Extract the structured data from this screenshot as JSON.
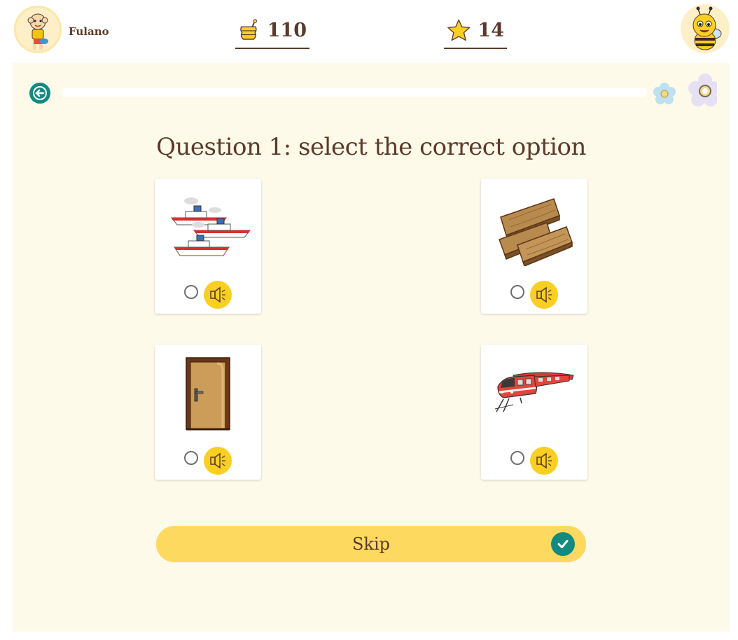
{
  "user": {
    "name": "Fulano",
    "avatar_icon": "child-character-avatar-icon"
  },
  "stats": {
    "honey": "110",
    "honey_icon": "honey-pot-icon",
    "stars": "14",
    "star_icon": "star-icon"
  },
  "mascot_icon": "bee-mascot-icon",
  "nav": {
    "back_icon": "back-arrow-icon"
  },
  "progress": {
    "fraction": 0.0,
    "markers": [
      "flower-icon",
      "flower-icon"
    ]
  },
  "question": {
    "title": "Question 1: select the correct option"
  },
  "options": [
    {
      "image": "ships-icon",
      "audio_icon": "speaker-icon"
    },
    {
      "image": "wooden-planks-icon",
      "audio_icon": "speaker-icon"
    },
    {
      "image": "door-icon",
      "audio_icon": "speaker-icon"
    },
    {
      "image": "train-icon",
      "audio_icon": "speaker-icon"
    }
  ],
  "skip": {
    "label": "Skip",
    "icon": "check-circle-icon"
  },
  "colors": {
    "accent_teal": "#128a80",
    "yellow": "#fed95f",
    "audio_yellow": "#f9cf22",
    "panel_bg": "#fefaea",
    "text_brown": "#5b3a2b"
  }
}
